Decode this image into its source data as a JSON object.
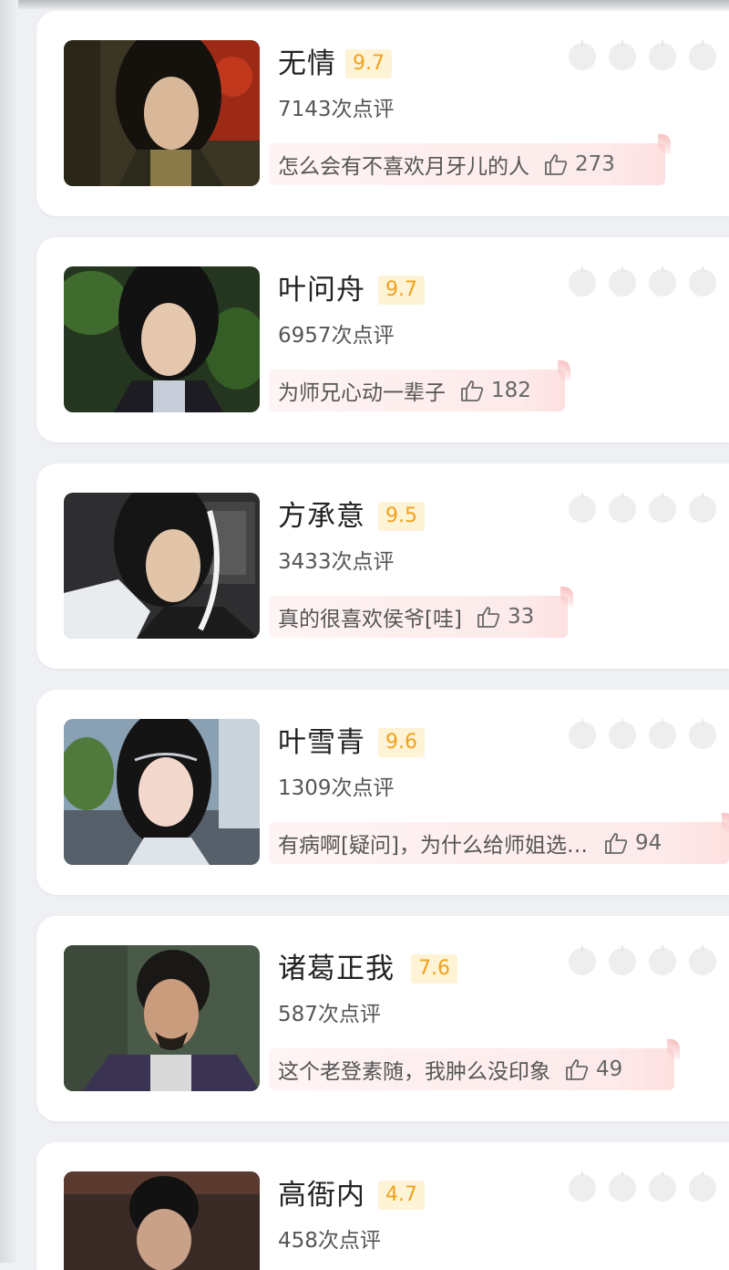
{
  "characters": [
    {
      "name": "无情",
      "score": "9.7",
      "reviews": "7143次点评",
      "comment": "怎么会有不喜欢月牙儿的人",
      "likes": "273"
    },
    {
      "name": "叶问舟",
      "score": "9.7",
      "reviews": "6957次点评",
      "comment": "为师兄心动一辈子",
      "likes": "182"
    },
    {
      "name": "方承意",
      "score": "9.5",
      "reviews": "3433次点评",
      "comment": "真的很喜欢侯爷[哇]",
      "likes": "33"
    },
    {
      "name": "叶雪青",
      "score": "9.6",
      "reviews": "1309次点评",
      "comment": "有病啊[疑问]，为什么给师姐选…",
      "likes": "94"
    },
    {
      "name": "诸葛正我",
      "score": "7.6",
      "reviews": "587次点评",
      "comment": "这个老登素随，我肿么没印象",
      "likes": "49"
    },
    {
      "name": "高衙内",
      "score": "4.7",
      "reviews": "458次点评",
      "comment": "",
      "likes": ""
    }
  ],
  "colors": {
    "score_text": "#f0a21d",
    "score_bg": "#fff3d6",
    "review_bg": "#fdeaea"
  }
}
